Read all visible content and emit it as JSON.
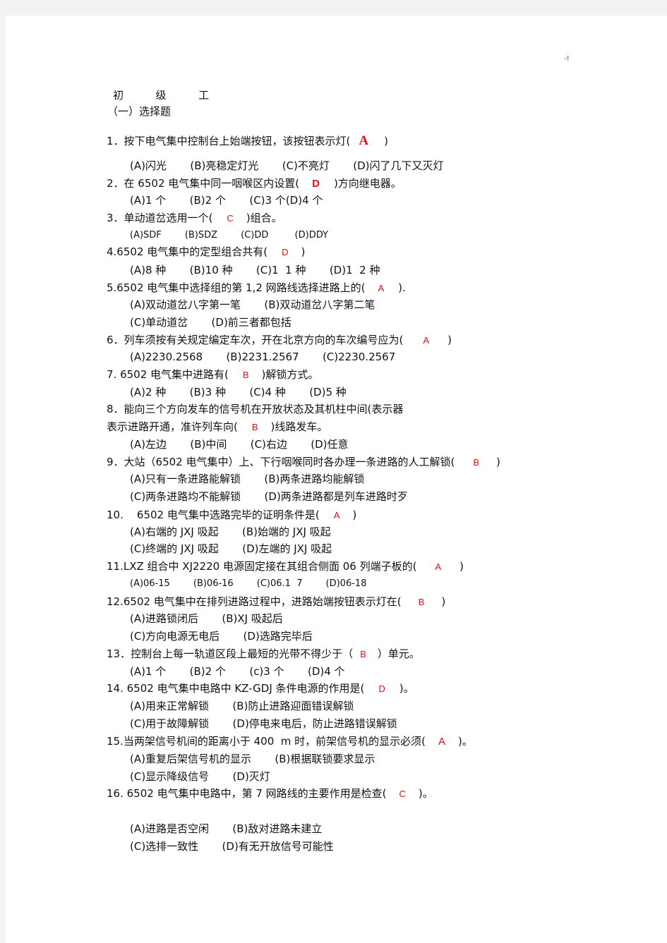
{
  "corner_mark": "-!",
  "header": {
    "level": "初  级  工",
    "section": "（一）选择题"
  },
  "questions": [
    {
      "stem_before": "1．按下电气集中控制台上始端按钮，该按钮表示灯(",
      "answer": "A",
      "stem_after": ")",
      "option_lines": [
        "(A)闪光       (B)亮稳定灯光       (C)不亮灯       (D)闪了几下又灭灯"
      ]
    },
    {
      "stem_before": "2．在 6502 电气集中同一咽喉区内设置(",
      "answer": "D",
      "stem_after": ")方向继电器。",
      "option_lines": [
        "(A)1 个       (B)2 个       (C)3 个(D)4 个"
      ]
    },
    {
      "stem_before": "3．单动道岔选用一个(",
      "answer": "C",
      "stem_after": ")组合。",
      "option_lines": [
        "(A)SDF        (B)SDZ        (C)DD         (D)DDY"
      ]
    },
    {
      "stem_before": "4.6502 电气集中的定型组合共有(",
      "answer": "D",
      "stem_after": ")",
      "option_lines": [
        "(A)8 种       (B)10 种       (C)1  1 种       (D)1  2 种"
      ]
    },
    {
      "stem_before": "5.6502 电气集中选择组的第 1,2 网路线选择进路上的(",
      "answer": "A",
      "stem_after": ").",
      "option_lines": [
        "(A)双动道岔八字第一笔       (B)双动道岔八字第二笔",
        "(C)单动道岔       (D)前三者都包括"
      ]
    },
    {
      "stem_before": "6．列车须按有关规定编定车次，开在北京方向的车次编号应为(",
      "answer": "A",
      "stem_after": ")",
      "option_lines": [
        "(A)2230.2568       (B)2231.2567       (C)2230.2567"
      ]
    },
    {
      "stem_before": "7. 6502 电气集中进路有(",
      "answer": "B",
      "stem_after": ")解锁方式。",
      "option_lines": [
        "(A)2 种       (B)3 种       (C)4 种       (D)5 种"
      ]
    },
    {
      "stem_before": "8．能向三个方向发车的信号机在开放状态及其机柱中间(表示器",
      "stem_line2_before": "表示进路开通，准许列车向(",
      "answer": "B",
      "stem_after": ")线路发车。",
      "option_lines": [
        "(A)左边       (B)中间       (C)右边       (D)任意"
      ]
    },
    {
      "stem_before": "9．大站（6502 电气集中）上、下行咽喉同时各办理一条进路的人工解锁(",
      "answer": "B",
      "stem_after": ")",
      "option_lines": [
        "(A)只有一条进路能解锁       (B)两条进路均能解锁",
        "(C)两条进路均不能解锁       (D)两条进路都是列车进路时歹"
      ]
    },
    {
      "stem_before": "10.    6502 电气集中选路完毕的证明条件是(",
      "answer": "A",
      "stem_after": ")",
      "option_lines": [
        "(A)右端的 JXJ 吸起       (B)始端的 JXJ 吸起",
        "(C)终端的 JXJ 吸起       (D)左端的 JXJ 吸起"
      ]
    },
    {
      "stem_before": "11.LXZ 组合中 XJ2220 电源固定接在其组合侧面 06 列端子板的(",
      "answer": "A",
      "stem_after": ")",
      "option_lines": [
        "(A)06-15        (B)06-16        (C)06.1  7        (D)06-18"
      ]
    },
    {
      "stem_before": "12.6502 电气集中在排列进路过程中，进路始端按钮表示灯在(",
      "answer": "B",
      "stem_after": ")",
      "option_lines": [
        "(A)进路锁闭后       (B)XJ 吸起后",
        "(C)方向电源无电后       (D)选路完毕后"
      ]
    },
    {
      "stem_before": "13．控制台上每一轨道区段上最短的光带不得少于（",
      "answer": "B",
      "stem_after": "）单元。",
      "option_lines": [
        "(A)1 个       (B)2 个       (c)3 个       (D)4 个"
      ]
    },
    {
      "stem_before": "14. 6502 电气集中电路中 KZ-GDJ 条件电源的作用是(",
      "answer": "D",
      "stem_after": ")。",
      "option_lines": [
        "(A)用来正常解锁       (B)防止进路迎面错误解锁",
        "(C)用于故障解锁       (D)停电来电后，防止进路错误解锁"
      ]
    },
    {
      "stem_before": "15.当两架信号机间的距离小于 400  m 时，前架信号机的显示必须(",
      "answer": "A",
      "stem_after": ")。",
      "option_lines": [
        "(A)重复后架信号机的显示       (B)根据联锁要求显示",
        "(C)显示降级信号       (D)灭灯"
      ]
    },
    {
      "stem_before": "16. 6502 电气集中电路中，第 7 网路线的主要作用是检查(",
      "answer": "C",
      "stem_after": ")。",
      "option_lines": [
        "(A)进路是否空闲       (B)敌对进路未建立",
        "(C)选排一致性       (D)有无开放信号可能性"
      ]
    }
  ]
}
